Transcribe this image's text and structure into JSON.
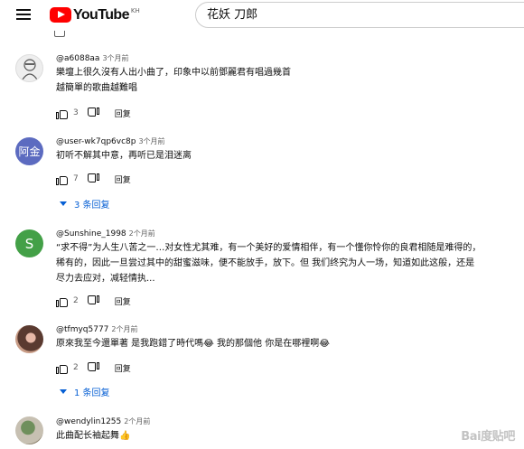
{
  "header": {
    "logo_text": "YouTube",
    "country_code": "KH",
    "search_value": "花妖 刀郎"
  },
  "comments": [
    {
      "handle": "@a6088aa",
      "time": "3个月前",
      "text": [
        "樂壇上很久沒有人出小曲了，印象中以前鄧麗君有唱過幾首",
        "越簡單的歌曲越難唱"
      ],
      "likes": "3",
      "reply_label": "回复",
      "avatar": "sketch"
    },
    {
      "handle": "@user-wk7qp6vc8p",
      "time": "3个月前",
      "text": [
        "初听不解其中意，再听已是泪迷离"
      ],
      "likes": "7",
      "reply_label": "回复",
      "avatar": "阿金",
      "replies_label": "3 条回复"
    },
    {
      "handle": "@Sunshine_1998",
      "time": "2个月前",
      "text": [
        "“求不得”为人生八苦之一…对女性尤其难，有一个美好的爱情相伴，有一个懂你怜你的良君相随是难得的，",
        "稀有的，因此一旦尝过其中的甜蜜滋味，便不能放手，放下。但 我们终究为人一场，知道如此这般，还是",
        "尽力去应对，减轻情执..."
      ],
      "likes": "2",
      "reply_label": "回复",
      "avatar": "S"
    },
    {
      "handle": "@tfmyq5777",
      "time": "2个月前",
      "text": [
        "原來我至今還單著 是我跑錯了時代嗎😂 我的那個他 你是在哪裡啊😂"
      ],
      "likes": "2",
      "reply_label": "回复",
      "avatar": "photo",
      "replies_label": "1 条回复"
    },
    {
      "handle": "@wendylin1255",
      "time": "2个月前",
      "text": [
        "此曲配长袖起舞👍"
      ],
      "avatar": "tree"
    }
  ],
  "watermark": "Bai度贴吧",
  "colors": {
    "brand_red": "#ff0000",
    "link_blue": "#065fd4",
    "avatar_purple": "#5c6bc0",
    "avatar_green": "#43a047"
  },
  "icons": [
    "menu-icon",
    "youtube-logo-icon",
    "like-icon",
    "dislike-icon",
    "caret-down-icon"
  ]
}
